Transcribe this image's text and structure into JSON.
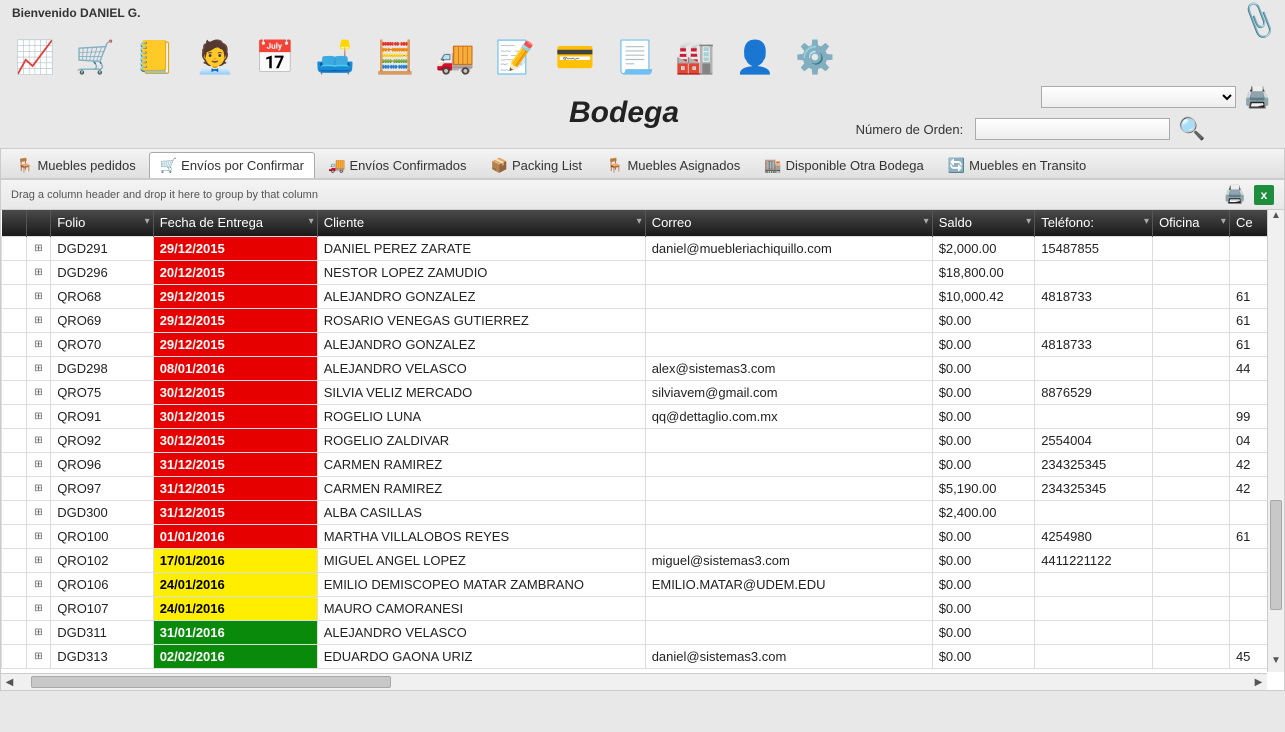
{
  "header": {
    "welcome": "Bienvenido DANIEL G."
  },
  "page_title": "Bodega",
  "order_label": "Número de Orden:",
  "group_hint": "Drag a column header and drop it here to group by that column",
  "tabs": [
    {
      "label": "Muebles pedidos"
    },
    {
      "label": "Envíos por Confirmar"
    },
    {
      "label": "Envíos Confirmados"
    },
    {
      "label": "Packing List"
    },
    {
      "label": "Muebles Asignados"
    },
    {
      "label": "Disponible Otra Bodega"
    },
    {
      "label": "Muebles en Transito"
    }
  ],
  "columns": {
    "c0": "",
    "c1": "",
    "folio": "Folio",
    "fecha": "Fecha de Entrega",
    "cliente": "Cliente",
    "correo": "Correo",
    "saldo": "Saldo",
    "telefono": "Teléfono:",
    "oficina": "Oficina",
    "cel": "Ce"
  },
  "rows": [
    {
      "folio": "DGD291",
      "fecha": "29/12/2015",
      "fclass": "date-red",
      "cliente": "DANIEL  PEREZ ZARATE",
      "correo": "daniel@muebleriachiquillo.com",
      "saldo": "$2,000.00",
      "telefono": "15487855",
      "oficina": "",
      "cel": ""
    },
    {
      "folio": "DGD296",
      "fecha": "20/12/2015",
      "fclass": "date-red",
      "cliente": "NESTOR  LOPEZ  ZAMUDIO",
      "correo": "",
      "saldo": "$18,800.00",
      "telefono": "",
      "oficina": "",
      "cel": ""
    },
    {
      "folio": "QRO68",
      "fecha": "29/12/2015",
      "fclass": "date-red",
      "cliente": "ALEJANDRO  GONZALEZ",
      "correo": "",
      "saldo": "$10,000.42",
      "telefono": "4818733",
      "oficina": "",
      "cel": "61"
    },
    {
      "folio": "QRO69",
      "fecha": "29/12/2015",
      "fclass": "date-red",
      "cliente": "ROSARIO  VENEGAS GUTIERREZ",
      "correo": "",
      "saldo": "$0.00",
      "telefono": "",
      "oficina": "",
      "cel": "61"
    },
    {
      "folio": "QRO70",
      "fecha": "29/12/2015",
      "fclass": "date-red",
      "cliente": "ALEJANDRO  GONZALEZ",
      "correo": "",
      "saldo": "$0.00",
      "telefono": "4818733",
      "oficina": "",
      "cel": "61"
    },
    {
      "folio": "DGD298",
      "fecha": "08/01/2016",
      "fclass": "date-red",
      "cliente": "ALEJANDRO VELASCO",
      "correo": "alex@sistemas3.com",
      "saldo": "$0.00",
      "telefono": "",
      "oficina": "",
      "cel": "44"
    },
    {
      "folio": "QRO75",
      "fecha": "30/12/2015",
      "fclass": "date-red",
      "cliente": "SILVIA   VELIZ  MERCADO",
      "correo": "silviavem@gmail.com",
      "saldo": "$0.00",
      "telefono": "8876529",
      "oficina": "",
      "cel": ""
    },
    {
      "folio": "QRO91",
      "fecha": "30/12/2015",
      "fclass": "date-red",
      "cliente": "ROGELIO LUNA",
      "correo": "qq@dettaglio.com.mx",
      "saldo": "$0.00",
      "telefono": "",
      "oficina": "",
      "cel": "99"
    },
    {
      "folio": "QRO92",
      "fecha": "30/12/2015",
      "fclass": "date-red",
      "cliente": "ROGELIO ZALDIVAR",
      "correo": "",
      "saldo": "$0.00",
      "telefono": "2554004",
      "oficina": "",
      "cel": "04"
    },
    {
      "folio": "QRO96",
      "fecha": "31/12/2015",
      "fclass": "date-red",
      "cliente": "CARMEN RAMIREZ",
      "correo": "",
      "saldo": "$0.00",
      "telefono": "234325345",
      "oficina": "",
      "cel": "42"
    },
    {
      "folio": "QRO97",
      "fecha": "31/12/2015",
      "fclass": "date-red",
      "cliente": "CARMEN RAMIREZ",
      "correo": "",
      "saldo": "$5,190.00",
      "telefono": "234325345",
      "oficina": "",
      "cel": "42"
    },
    {
      "folio": "DGD300",
      "fecha": "31/12/2015",
      "fclass": "date-red",
      "cliente": "ALBA CASILLAS",
      "correo": "",
      "saldo": "$2,400.00",
      "telefono": "",
      "oficina": "",
      "cel": ""
    },
    {
      "folio": "QRO100",
      "fecha": "01/01/2016",
      "fclass": "date-red",
      "cliente": "MARTHA  VILLALOBOS REYES",
      "correo": "",
      "saldo": "$0.00",
      "telefono": "4254980",
      "oficina": "",
      "cel": "61"
    },
    {
      "folio": "QRO102",
      "fecha": "17/01/2016",
      "fclass": "date-yellow",
      "cliente": "MIGUEL ANGEL LOPEZ",
      "correo": "miguel@sistemas3.com",
      "saldo": "$0.00",
      "telefono": "4411221122",
      "oficina": "",
      "cel": ""
    },
    {
      "folio": "QRO106",
      "fecha": "24/01/2016",
      "fclass": "date-yellow",
      "cliente": "EMILIO DEMISCOPEO MATAR ZAMBRANO",
      "correo": "EMILIO.MATAR@UDEM.EDU",
      "saldo": "$0.00",
      "telefono": "",
      "oficina": "",
      "cel": ""
    },
    {
      "folio": "QRO107",
      "fecha": "24/01/2016",
      "fclass": "date-yellow",
      "cliente": "MAURO CAMORANESI",
      "correo": "",
      "saldo": "$0.00",
      "telefono": "",
      "oficina": "",
      "cel": ""
    },
    {
      "folio": "DGD311",
      "fecha": "31/01/2016",
      "fclass": "date-green",
      "cliente": "ALEJANDRO  VELASCO",
      "correo": "",
      "saldo": "$0.00",
      "telefono": "",
      "oficina": "",
      "cel": ""
    },
    {
      "folio": "DGD313",
      "fecha": "02/02/2016",
      "fclass": "date-green",
      "cliente": "EDUARDO GAONA URIZ",
      "correo": "daniel@sistemas3.com",
      "saldo": "$0.00",
      "telefono": "",
      "oficina": "",
      "cel": "45"
    }
  ]
}
